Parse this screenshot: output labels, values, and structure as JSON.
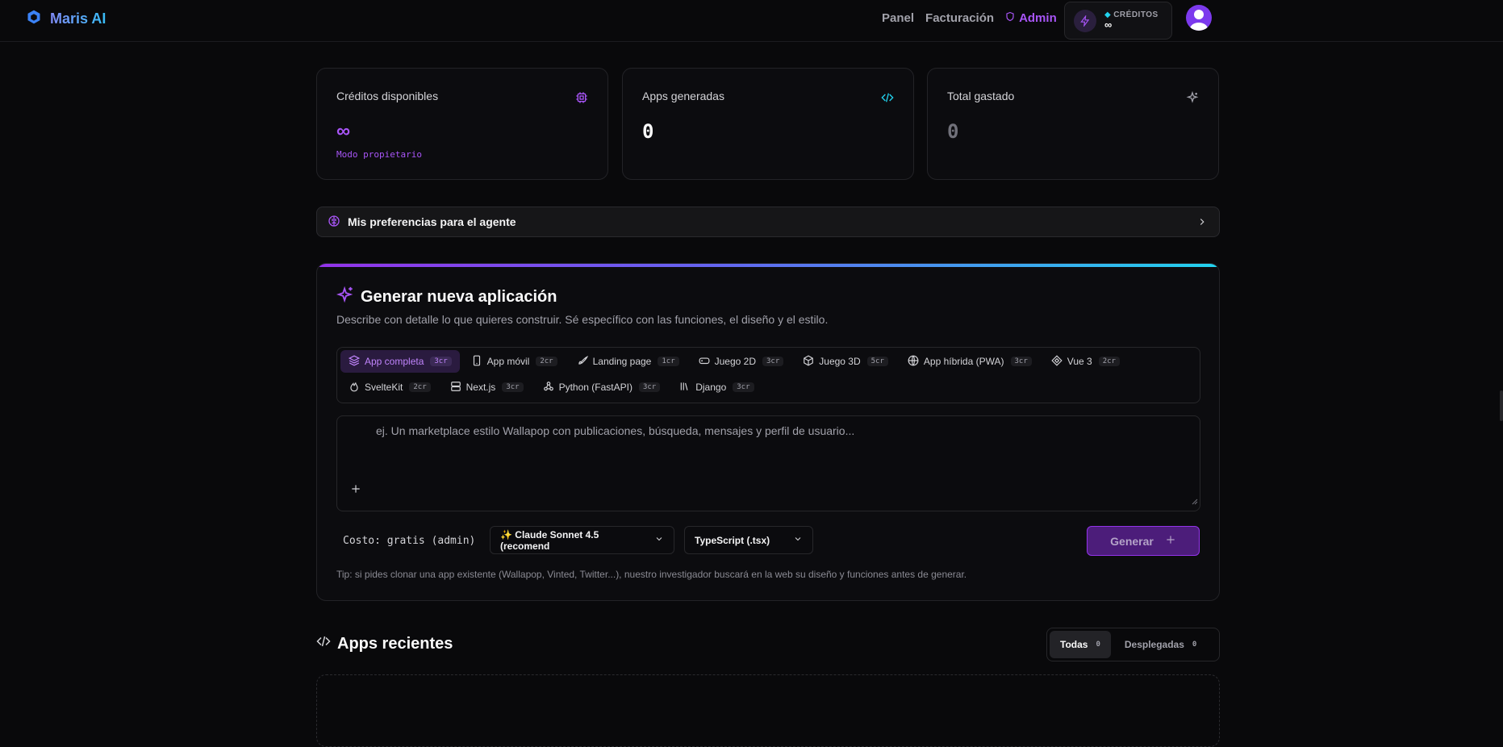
{
  "header": {
    "brand": "Maris AI",
    "nav": {
      "panel": "Panel",
      "billing": "Facturación",
      "admin": "Admin"
    },
    "credits": {
      "label": "CRÉDITOS",
      "value": "∞"
    }
  },
  "stats": [
    {
      "title": "Créditos disponibles",
      "value": "∞",
      "sub": "Modo propietario",
      "icon": "cpu-icon"
    },
    {
      "title": "Apps generadas",
      "value": "0",
      "icon": "code-icon"
    },
    {
      "title": "Total gastado",
      "value": "0",
      "icon": "sparkles-icon"
    }
  ],
  "prefs": {
    "label": "Mis preferencias para el agente"
  },
  "generator": {
    "title": "Generar nueva aplicación",
    "description": "Describe con detalle lo que quieres construir. Sé específico con las funciones, el diseño y el estilo.",
    "types": [
      {
        "label": "App completa",
        "cost": "3cr",
        "icon": "layers-icon",
        "active": true
      },
      {
        "label": "App móvil",
        "cost": "2cr",
        "icon": "smartphone-icon"
      },
      {
        "label": "Landing page",
        "cost": "1cr",
        "icon": "rocket-icon"
      },
      {
        "label": "Juego 2D",
        "cost": "3cr",
        "icon": "gamepad-icon"
      },
      {
        "label": "Juego 3D",
        "cost": "5cr",
        "icon": "box-icon"
      },
      {
        "label": "App híbrida (PWA)",
        "cost": "3cr",
        "icon": "globe-icon"
      },
      {
        "label": "Vue 3",
        "cost": "2cr",
        "icon": "vue-icon"
      },
      {
        "label": "SvelteKit",
        "cost": "2cr",
        "icon": "flame-icon"
      },
      {
        "label": "Next.js",
        "cost": "3cr",
        "icon": "server-icon"
      },
      {
        "label": "Python (FastAPI)",
        "cost": "3cr",
        "icon": "webhook-icon"
      },
      {
        "label": "Django",
        "cost": "3cr",
        "icon": "library-icon"
      }
    ],
    "placeholder": "ej. Un marketplace estilo Wallapop con publicaciones, búsqueda, mensajes y perfil de usuario...",
    "cost_text": "Costo: gratis (admin)",
    "model": "✨ Claude Sonnet 4.5 (recomend",
    "language": "TypeScript (.tsx)",
    "generate_label": "Generar",
    "tip": "Tip: si pides clonar una app existente (Wallapop, Vinted, Twitter...), nuestro investigador buscará en la web su diseño y funciones antes de generar."
  },
  "recent": {
    "title": "Apps recientes",
    "filters": [
      {
        "label": "Todas",
        "count": "0",
        "active": true
      },
      {
        "label": "Desplegadas",
        "count": "0"
      }
    ]
  },
  "colors": {
    "accent": "#a855f7",
    "accent_bg": "#4c1d7a",
    "brand": "#60a5fa",
    "cyan": "#22d3ee"
  }
}
